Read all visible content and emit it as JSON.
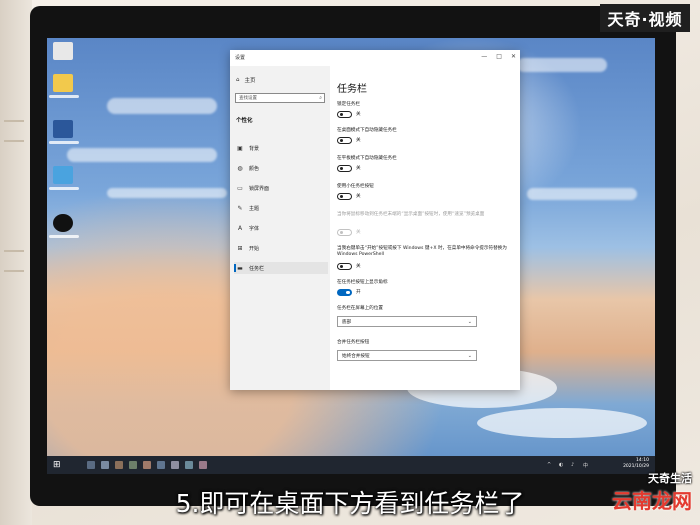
{
  "watermarks": {
    "top_right": "天奇·视频",
    "bottom_right_top": "天奇生活",
    "bottom_right_main": "云南龙网"
  },
  "caption": "5.即可在桌面下方看到任务栏了",
  "settings_window": {
    "title": "设置",
    "controls": {
      "minimize": "—",
      "maximize": "□",
      "close": "✕"
    },
    "nav": {
      "home": "主页",
      "search_placeholder": "查找设置",
      "section": "个性化",
      "items": [
        {
          "label": "背景",
          "icon": "image-icon"
        },
        {
          "label": "颜色",
          "icon": "palette-icon"
        },
        {
          "label": "锁屏界面",
          "icon": "lock-screen-icon"
        },
        {
          "label": "主题",
          "icon": "brush-icon"
        },
        {
          "label": "字体",
          "icon": "font-icon"
        },
        {
          "label": "开始",
          "icon": "start-icon"
        },
        {
          "label": "任务栏",
          "icon": "taskbar-icon",
          "active": true
        }
      ]
    },
    "content": {
      "heading": "任务栏",
      "options": [
        {
          "label": "锁定任务栏",
          "state": "关"
        },
        {
          "label": "在桌面模式下自动隐藏任务栏",
          "state": "关"
        },
        {
          "label": "在平板模式下自动隐藏任务栏",
          "state": "关"
        },
        {
          "label": "使用小任务栏按钮",
          "state": "关"
        },
        {
          "label": "当你将鼠标移动到任务栏末端的“显示桌面”按钮时，使用“速览”预览桌面",
          "state": "关",
          "disabled": true
        },
        {
          "label": "当我右键单击“开始”按钮或按下 Windows 键+X 时，在菜单中将命令提示符替换为 Windows PowerShell",
          "state": "关"
        },
        {
          "label": "在任务栏按钮上显示角标",
          "state": "开",
          "on": true
        }
      ],
      "position_label": "任务栏在屏幕上的位置",
      "position_value": "底部",
      "combine_label": "合并任务栏按钮",
      "combine_value": "始终合并按钮"
    }
  },
  "taskbar": {
    "start_icon": "windows-logo-icon",
    "clock_time": "14:10",
    "clock_date": "2021/10/29"
  },
  "colors": {
    "accent": "#0067c0",
    "taskbar": "#202630",
    "caption_text": "#ffffff",
    "logo_red": "#e33a2f"
  }
}
